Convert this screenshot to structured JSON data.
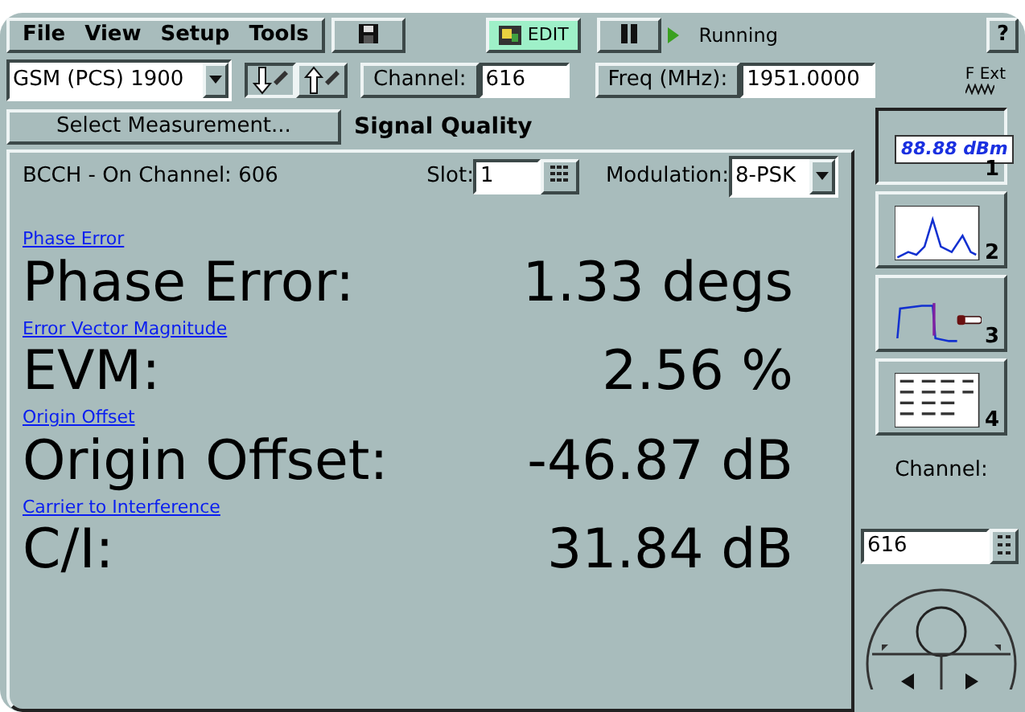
{
  "menu": [
    "File",
    "View",
    "Setup",
    "Tools"
  ],
  "toolbar": {
    "edit_label": "EDIT",
    "status": "Running",
    "help": "?"
  },
  "band": {
    "value": "GSM (PCS) 1900"
  },
  "channel": {
    "label": "Channel:",
    "value": "616"
  },
  "freq": {
    "label": "Freq (MHz):",
    "value": "1951.0000"
  },
  "ext": {
    "label": "F Ext"
  },
  "select_button": "Select Measurement...",
  "title": "Signal Quality",
  "panel": {
    "info": "BCCH - On Channel: 606",
    "slot_label": "Slot:",
    "slot_value": "1",
    "modulation_label": "Modulation:",
    "modulation_value": "8-PSK"
  },
  "measurements": [
    {
      "link": "Phase Error",
      "label": "Phase Error:",
      "value": "1.33 degs"
    },
    {
      "link": "Error Vector Magnitude",
      "label": "EVM:",
      "value": "2.56 %"
    },
    {
      "link": "Origin Offset",
      "label": "Origin Offset:",
      "value": "-46.87 dB"
    },
    {
      "link": "Carrier to Interference",
      "label": "C/I:",
      "value": "31.84 dB"
    }
  ],
  "views": [
    {
      "kind": "numeric",
      "readout": "88.88 dBm",
      "number": "1",
      "selected": true
    },
    {
      "kind": "spectrum",
      "number": "2",
      "selected": false
    },
    {
      "kind": "power",
      "number": "3",
      "selected": false
    },
    {
      "kind": "table",
      "number": "4",
      "selected": false
    }
  ],
  "side_channel": {
    "label": "Channel:",
    "value": "616"
  }
}
